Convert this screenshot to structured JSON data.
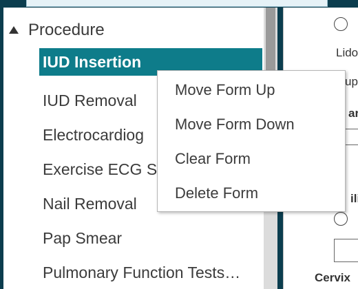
{
  "tree": {
    "group_label": "Procedure",
    "items": [
      {
        "label": "IUD Insertion",
        "selected": true
      },
      {
        "label": "IUD Removal"
      },
      {
        "label": "Electrocardiog"
      },
      {
        "label": "Exercise ECG S"
      },
      {
        "label": "Nail Removal"
      },
      {
        "label": "Pap Smear"
      },
      {
        "label": "Pulmonary Function Tests…"
      }
    ]
  },
  "context_menu": {
    "items": [
      {
        "label": "Move Form Up"
      },
      {
        "label": "Move Form Down"
      },
      {
        "label": "Clear Form"
      },
      {
        "label": "Delete Form"
      }
    ]
  },
  "right_panel": {
    "text_lido": "Lido",
    "text_up": "up",
    "text_ar": "ar",
    "text_ili": "ili",
    "label_cervix": "Cervix"
  },
  "colors": {
    "background": "#0b3d4e",
    "selected": "#0e7c8a"
  }
}
